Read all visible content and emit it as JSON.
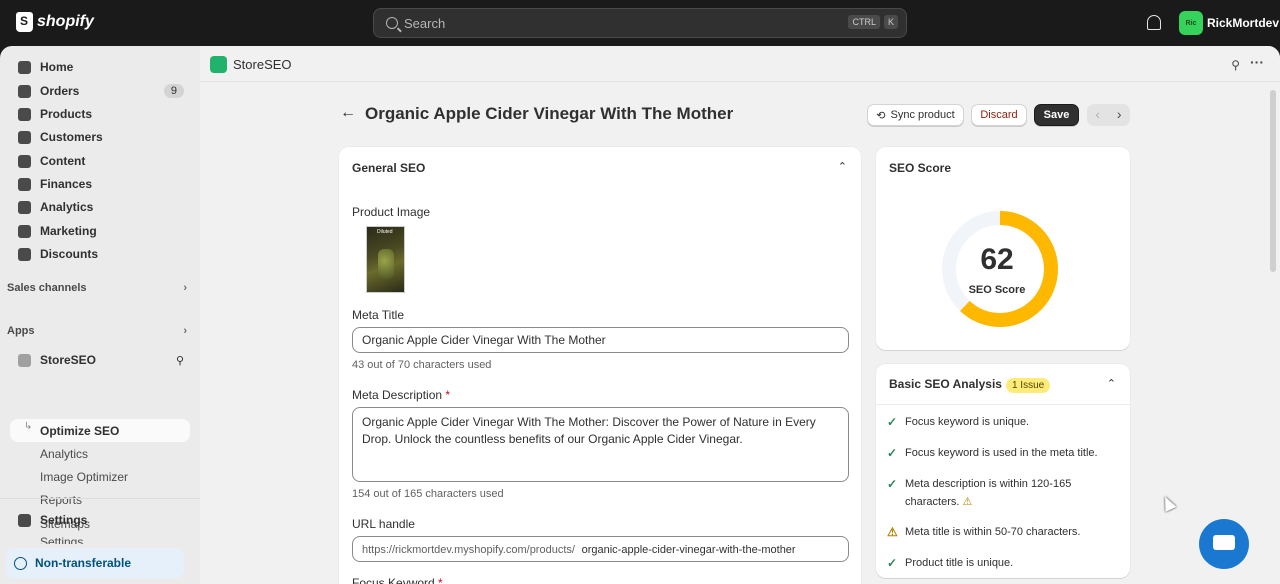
{
  "topbar": {
    "brand": "shopify",
    "search_placeholder": "Search",
    "kbd": [
      "CTRL",
      "K"
    ],
    "avatar_initials": "Ric",
    "username": "RickMortdev"
  },
  "sidebar": {
    "items": [
      {
        "label": "Home",
        "icon": "home-icon"
      },
      {
        "label": "Orders",
        "icon": "orders-icon",
        "count": "9"
      },
      {
        "label": "Products",
        "icon": "tag-icon"
      },
      {
        "label": "Customers",
        "icon": "person-icon"
      },
      {
        "label": "Content",
        "icon": "content-icon"
      },
      {
        "label": "Finances",
        "icon": "bank-icon"
      },
      {
        "label": "Analytics",
        "icon": "chart-icon"
      },
      {
        "label": "Marketing",
        "icon": "target-icon"
      },
      {
        "label": "Discounts",
        "icon": "discount-icon"
      }
    ],
    "sales_channels": "Sales channels",
    "apps": "Apps",
    "app_name": "StoreSEO",
    "app_subitems": [
      "Optimize SEO",
      "Analytics",
      "Image Optimizer",
      "Reports",
      "Sitemaps",
      "Settings"
    ],
    "settings": "Settings",
    "non_transferable": "Non-transferable"
  },
  "app_header": {
    "title": "StoreSEO"
  },
  "page": {
    "title": "Organic Apple Cider Vinegar With The Mother",
    "sync_label": "Sync product",
    "discard_label": "Discard",
    "save_label": "Save"
  },
  "general_seo": {
    "heading": "General SEO",
    "product_image_label": "Product Image",
    "thumb_text": "Diluted",
    "meta_title_label": "Meta Title",
    "meta_title_value": "Organic Apple Cider Vinegar With The Mother",
    "meta_title_help": "43 out of 70 characters used",
    "meta_desc_label": "Meta Description",
    "meta_desc_value": "Organic Apple Cider Vinegar With The Mother: Discover the Power of Nature in Every Drop. Unlock the countless benefits of our Organic Apple Cider Vinegar.",
    "meta_desc_help": "154 out of 165 characters used",
    "url_label": "URL handle",
    "url_prefix": "https://rickmortdev.myshopify.com/products/",
    "url_value": "organic-apple-cider-vinegar-with-the-mother",
    "focus_label": "Focus Keyword"
  },
  "seo_score": {
    "heading": "SEO Score",
    "score": 62,
    "score_text": "62",
    "label": "SEO Score",
    "colors": {
      "arc": "#ffb800",
      "track": "#f1f4f8"
    }
  },
  "basic_analysis": {
    "heading": "Basic SEO Analysis",
    "badge": "1 Issue",
    "checks": [
      {
        "text": "Focus keyword is unique.",
        "status": "pass"
      },
      {
        "text": "Focus keyword is used in the meta title.",
        "status": "pass"
      },
      {
        "text": "Meta description is within 120-165 characters.",
        "status": "pass"
      },
      {
        "text": "Meta title is within 50-70 characters.",
        "status": "warn"
      },
      {
        "text": "Product title is unique.",
        "status": "pass"
      }
    ]
  }
}
